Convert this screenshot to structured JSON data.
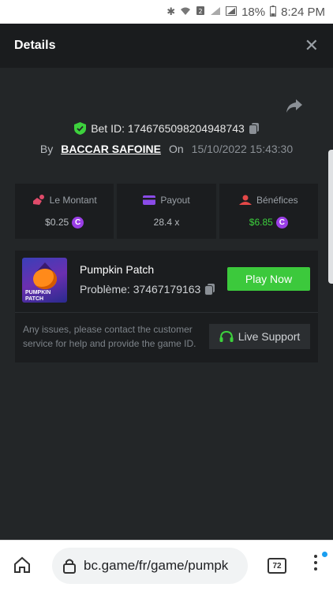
{
  "status_bar": {
    "battery": "18%",
    "time": "8:24 PM"
  },
  "modal": {
    "title": "Details",
    "close_icon": "close-icon",
    "share_icon": "share-icon"
  },
  "bet": {
    "label": "Bet ID: 1746765098204948743",
    "by_label": "By",
    "user": "BACCAR SAFOINE",
    "on_label": "On",
    "date": "15/10/2022 15:43:30"
  },
  "stats": [
    {
      "label": "Le Montant",
      "value": "$0.25",
      "icon": "hand-coins-icon",
      "color": "#e04b6a"
    },
    {
      "label": "Payout",
      "value": "28.4 x",
      "icon": "card-icon",
      "color": "#8a4be8"
    },
    {
      "label": "Bénéfices",
      "value": "$6.85",
      "icon": "profit-icon",
      "color": "#e34848"
    }
  ],
  "game": {
    "thumbnail_caption": "PUMPKIN PATCH",
    "name": "Pumpkin Patch",
    "problem": "Problème: 37467179163",
    "play_label": "Play Now",
    "support_text": "Any issues, please contact the customer service for help and provide the game ID.",
    "support_label": "Live Support"
  },
  "browser": {
    "url": "bc.game/fr/game/pumpk",
    "tab_count": "72"
  },
  "colors": {
    "accent_green": "#3cc93c",
    "coin_purple": "#9a3ee6",
    "profit_green": "#3dd13d"
  }
}
